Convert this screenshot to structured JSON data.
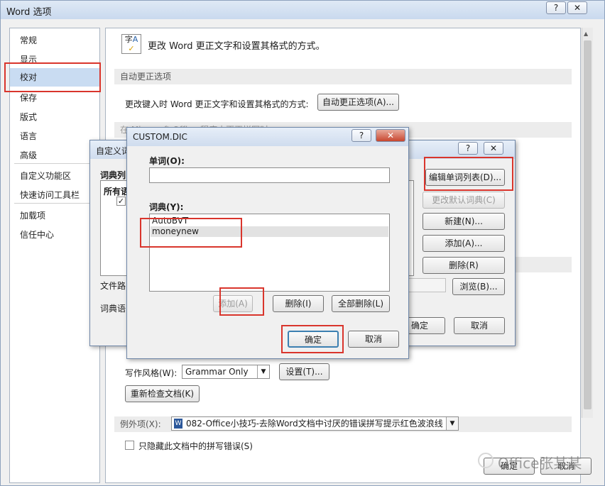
{
  "window": {
    "title": "Word 选项",
    "help_btn": "?",
    "close_btn": "✕"
  },
  "sidebar": {
    "items": [
      {
        "label": "常规"
      },
      {
        "label": "显示"
      },
      {
        "label": "校对"
      },
      {
        "label": "保存"
      },
      {
        "label": "版式"
      },
      {
        "label": "语言"
      },
      {
        "label": "高级"
      },
      {
        "label": "自定义功能区"
      },
      {
        "label": "快速访问工具栏"
      },
      {
        "label": "加载项"
      },
      {
        "label": "信任中心"
      }
    ]
  },
  "main": {
    "header": "更改 Word 更正文字和设置其格式的方式。",
    "autocorrect_section": "自动更正选项",
    "autocorrect_desc": "更改键入时 Word 更正文字和设置其格式的方式:",
    "autocorrect_button": "自动更正选项(A)...",
    "hidden_section": "在 Microsoft Office 程序中更正拼写时",
    "writing_style_label": "写作风格(W):",
    "writing_style_value": "Grammar Only",
    "settings_button": "设置(T)...",
    "recheck_button": "重新检查文档(K)",
    "exceptions_label": "例外项(X):",
    "exceptions_value": "082-Office小技巧-去除Word文档中讨厌的错误拼写提示红色波浪线",
    "hide_errors_label": "只隐藏此文档中的拼写错误(S)",
    "ok_button": "确定",
    "cancel_button": "取消"
  },
  "custom_dict_dialog": {
    "title": "自定义词",
    "help_btn": "?",
    "close_btn": "✕",
    "list_label": "词典列",
    "all_lang": "所有语",
    "edit_list_button": "编辑单词列表(D)...",
    "change_default_button": "更改默认词典(C)",
    "new_button": "新建(N)...",
    "add_button": "添加(A)...",
    "delete_button": "删除(R)",
    "file_path_label": "文件路",
    "browse_button": "浏览(B)...",
    "dict_lang_label": "词典语",
    "ok_button": "确定",
    "cancel_button": "取消"
  },
  "custom_dic": {
    "title": "CUSTOM.DIC",
    "help_btn": "?",
    "close_btn": "✕",
    "word_label": "单词(O):",
    "word_value": "",
    "dict_label": "词典(Y):",
    "entries": [
      "AutoBVT",
      "moneynew"
    ],
    "add_button": "添加(A)",
    "delete_button": "删除(I)",
    "delete_all_button": "全部删除(L)",
    "ok_button": "确定",
    "cancel_button": "取消"
  },
  "watermark": "Office张某某",
  "colors": {
    "highlight_red": "#d9352c",
    "selection_blue": "#c9dcf2"
  }
}
